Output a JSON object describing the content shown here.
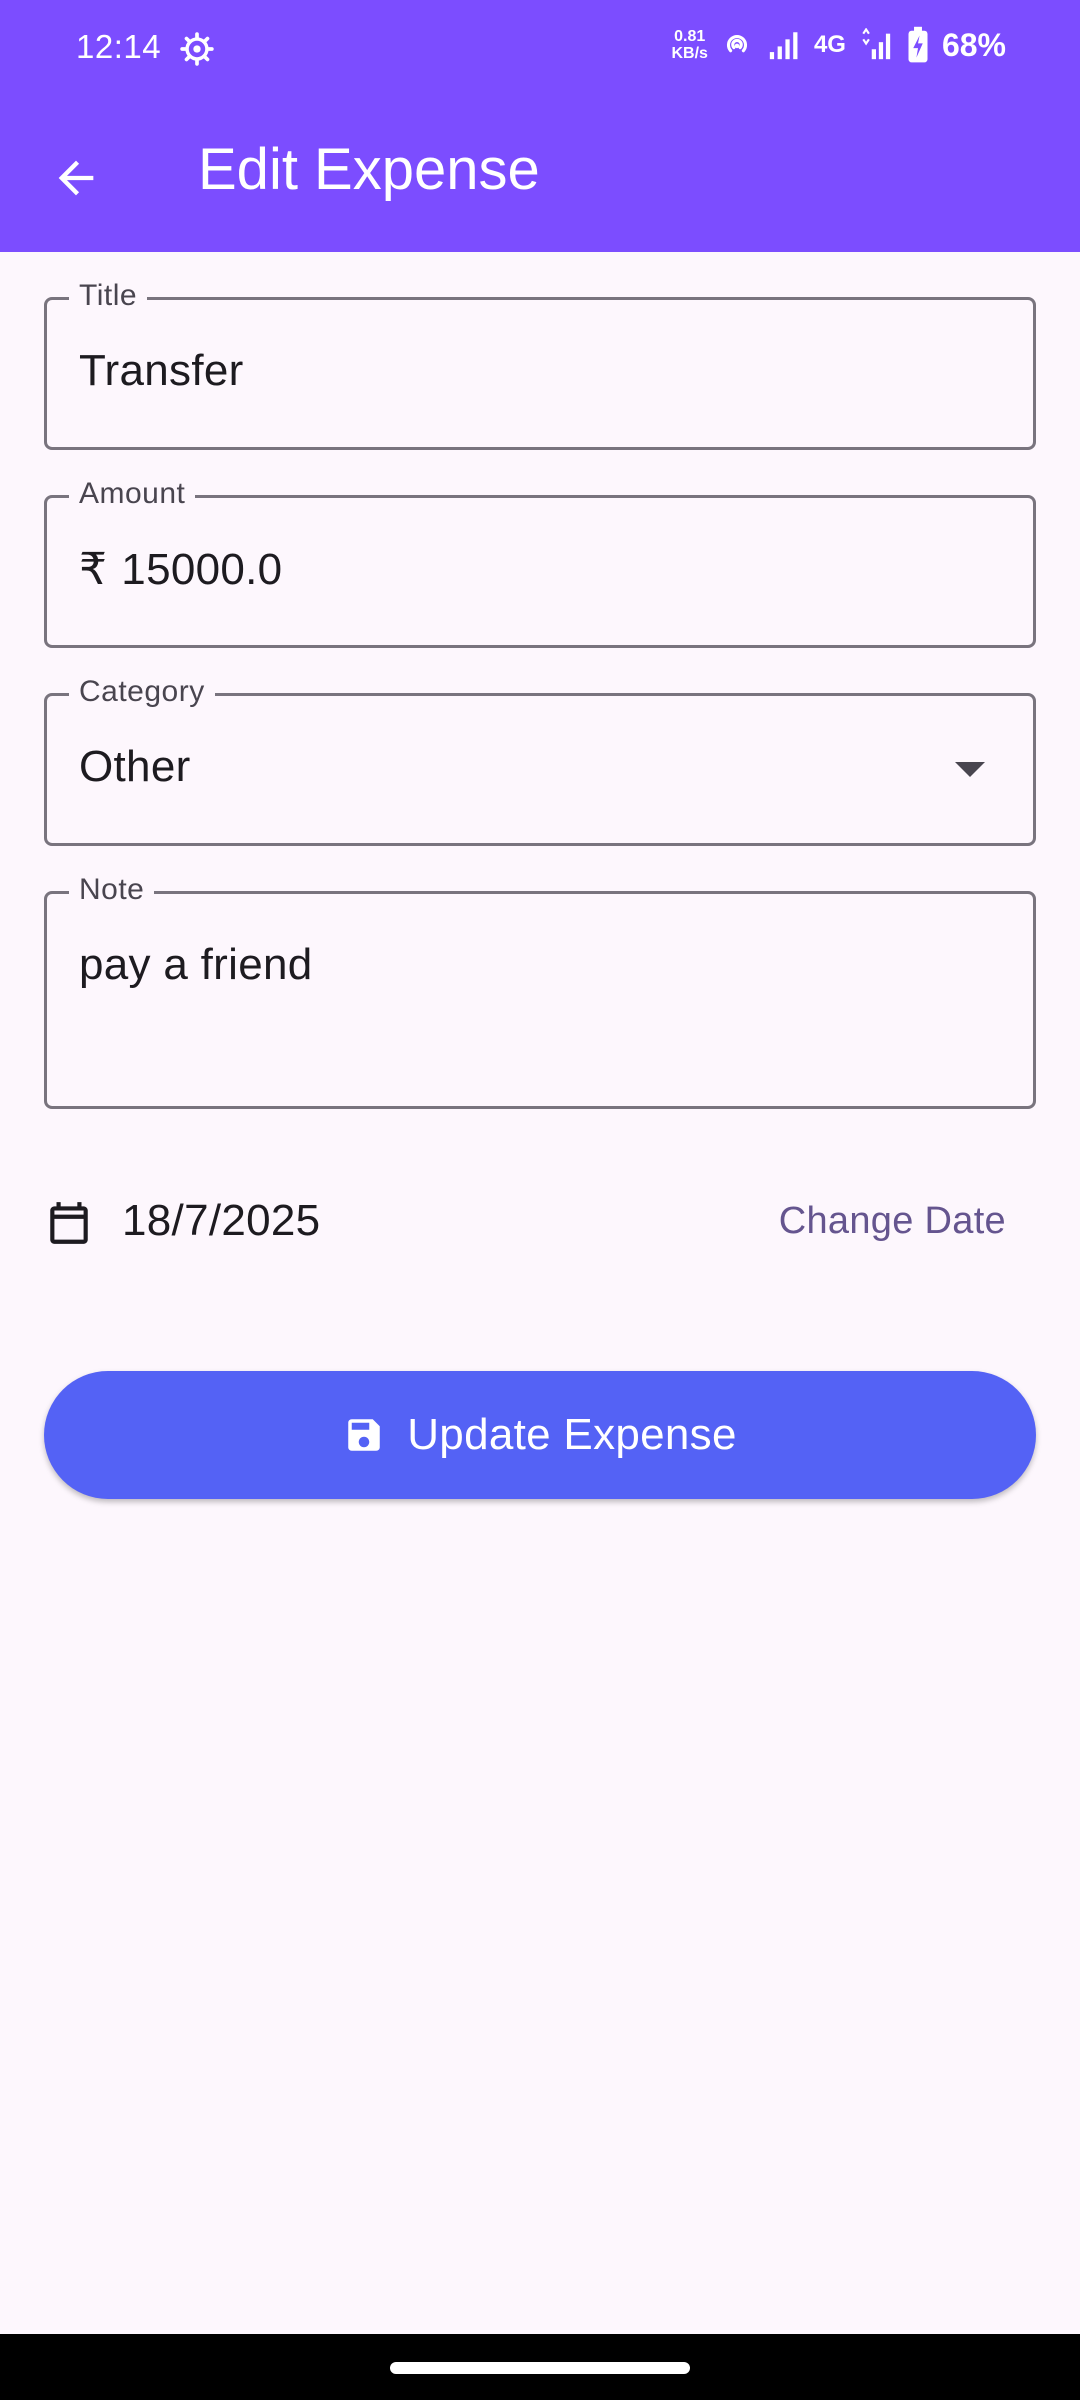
{
  "status_bar": {
    "time": "12:14",
    "speed_value": "0.81",
    "speed_unit": "KB/s",
    "network": "4G",
    "battery_percent": "68%"
  },
  "app_bar": {
    "title": "Edit Expense",
    "back_icon": "arrow-back-icon"
  },
  "form": {
    "title": {
      "label": "Title",
      "value": "Transfer"
    },
    "amount": {
      "label": "Amount",
      "currency_symbol": "₹",
      "value": "15000.0"
    },
    "category": {
      "label": "Category",
      "value": "Other"
    },
    "note": {
      "label": "Note",
      "value": "pay a friend"
    }
  },
  "date_row": {
    "date": "18/7/2025",
    "change_label": "Change Date",
    "icon": "calendar-icon"
  },
  "update_button": {
    "label": "Update Expense",
    "icon": "save-icon"
  },
  "colors": {
    "app_bar": "#7c4dff",
    "button": "#5462f5",
    "link": "#65558f",
    "background": "#fdf7fd"
  }
}
